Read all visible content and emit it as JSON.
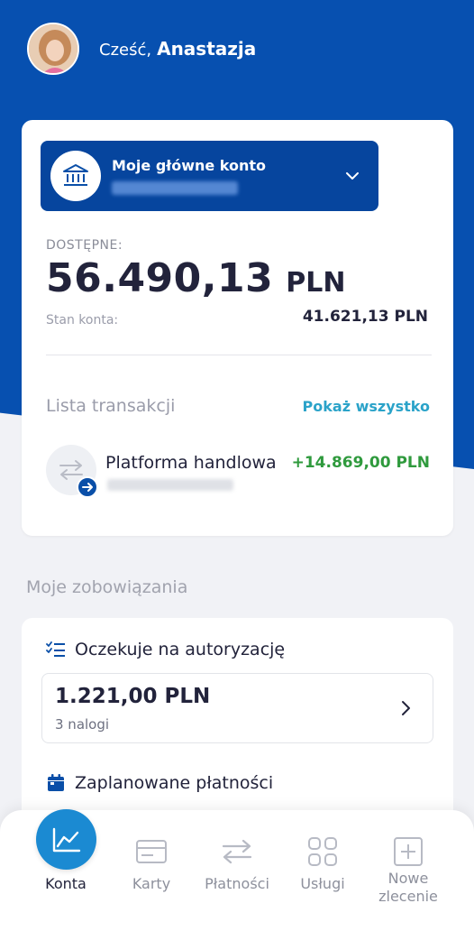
{
  "header": {
    "greeting": "Cześć,",
    "name": "Anastazja"
  },
  "account": {
    "name": "Moje główne konto",
    "available_label": "DOSTĘPNE:",
    "available_amount": "56.490,13",
    "currency": "PLN",
    "balance_label": "Stan konta:",
    "balance_value": "41.621,13 PLN"
  },
  "transactions": {
    "title": "Lista transakcji",
    "show_all": "Pokaż wszystko",
    "items": [
      {
        "name": "Platforma handlowa",
        "amount": "+14.869,00 PLN"
      }
    ]
  },
  "obligations": {
    "title": "Moje zobowiązania",
    "authorization": {
      "label": "Oczekuje na autoryzację",
      "amount": "1.221,00 PLN",
      "count": "3 nalogi"
    },
    "planned": {
      "label": "Zaplanowane płatności"
    }
  },
  "nav": {
    "items": [
      {
        "label": "Konta",
        "icon": "chart-line-icon",
        "active": true
      },
      {
        "label": "Karty",
        "icon": "card-icon"
      },
      {
        "label": "Płatności",
        "icon": "transfer-arrows-icon"
      },
      {
        "label": "Usługi",
        "icon": "grid-icon"
      },
      {
        "label": "Nowe zlecenie",
        "icon": "plus-square-icon"
      }
    ]
  },
  "colors": {
    "primary_blue": "#0750b0",
    "account_box": "#06459e",
    "accent_link": "#2ba3c9",
    "positive": "#2f9a3d",
    "active_nav": "#1b8ad2"
  }
}
